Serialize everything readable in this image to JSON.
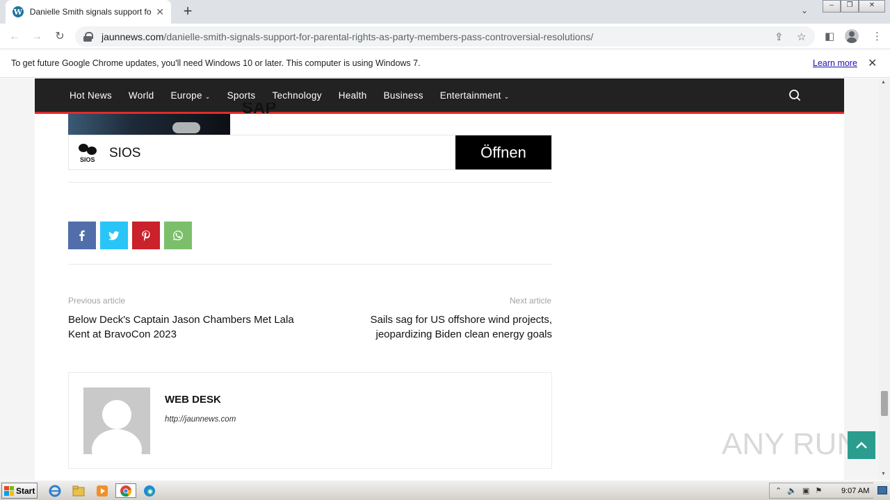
{
  "browser": {
    "tab_title": "Danielle Smith signals support for 'pa",
    "url_host": "jaunnews.com",
    "url_path": "/danielle-smith-signals-support-for-parental-rights-as-party-members-pass-controversial-resolutions/",
    "infobar_message": "To get future Google Chrome updates, you'll need Windows 10 or later. This computer is using Windows 7.",
    "infobar_link": "Learn more"
  },
  "site_nav": {
    "items": [
      {
        "label": "Hot News",
        "dropdown": false
      },
      {
        "label": "World",
        "dropdown": false
      },
      {
        "label": "Europe",
        "dropdown": true
      },
      {
        "label": "Sports",
        "dropdown": false
      },
      {
        "label": "Technology",
        "dropdown": false
      },
      {
        "label": "Health",
        "dropdown": false
      },
      {
        "label": "Business",
        "dropdown": false
      },
      {
        "label": "Entertainment",
        "dropdown": true
      }
    ]
  },
  "ad": {
    "headline_fragment": "SAP",
    "advertiser": "SIOS",
    "logo_text": "SIOS",
    "cta": "Öffnen"
  },
  "share": {
    "buttons": [
      {
        "name": "facebook",
        "color": "#516eab"
      },
      {
        "name": "twitter",
        "color": "#29c5f6"
      },
      {
        "name": "pinterest",
        "color": "#ca212a"
      },
      {
        "name": "whatsapp",
        "color": "#7bbf6a"
      }
    ]
  },
  "article_nav": {
    "prev_label": "Previous article",
    "prev_title": "Below Deck's Captain Jason Chambers Met Lala Kent at BravoCon 2023",
    "next_label": "Next article",
    "next_title": "Sails sag for US offshore wind projects, jeopardizing Biden clean energy goals"
  },
  "author": {
    "name": "WEB DESK",
    "url": "http://jaunnews.com"
  },
  "watermark": "ANY RUN",
  "taskbar": {
    "start_label": "Start",
    "clock": "9:07 AM"
  },
  "colors": {
    "nav_bg": "#222222",
    "nav_accent": "#e02b2b",
    "back_to_top": "#2a9d8f"
  }
}
